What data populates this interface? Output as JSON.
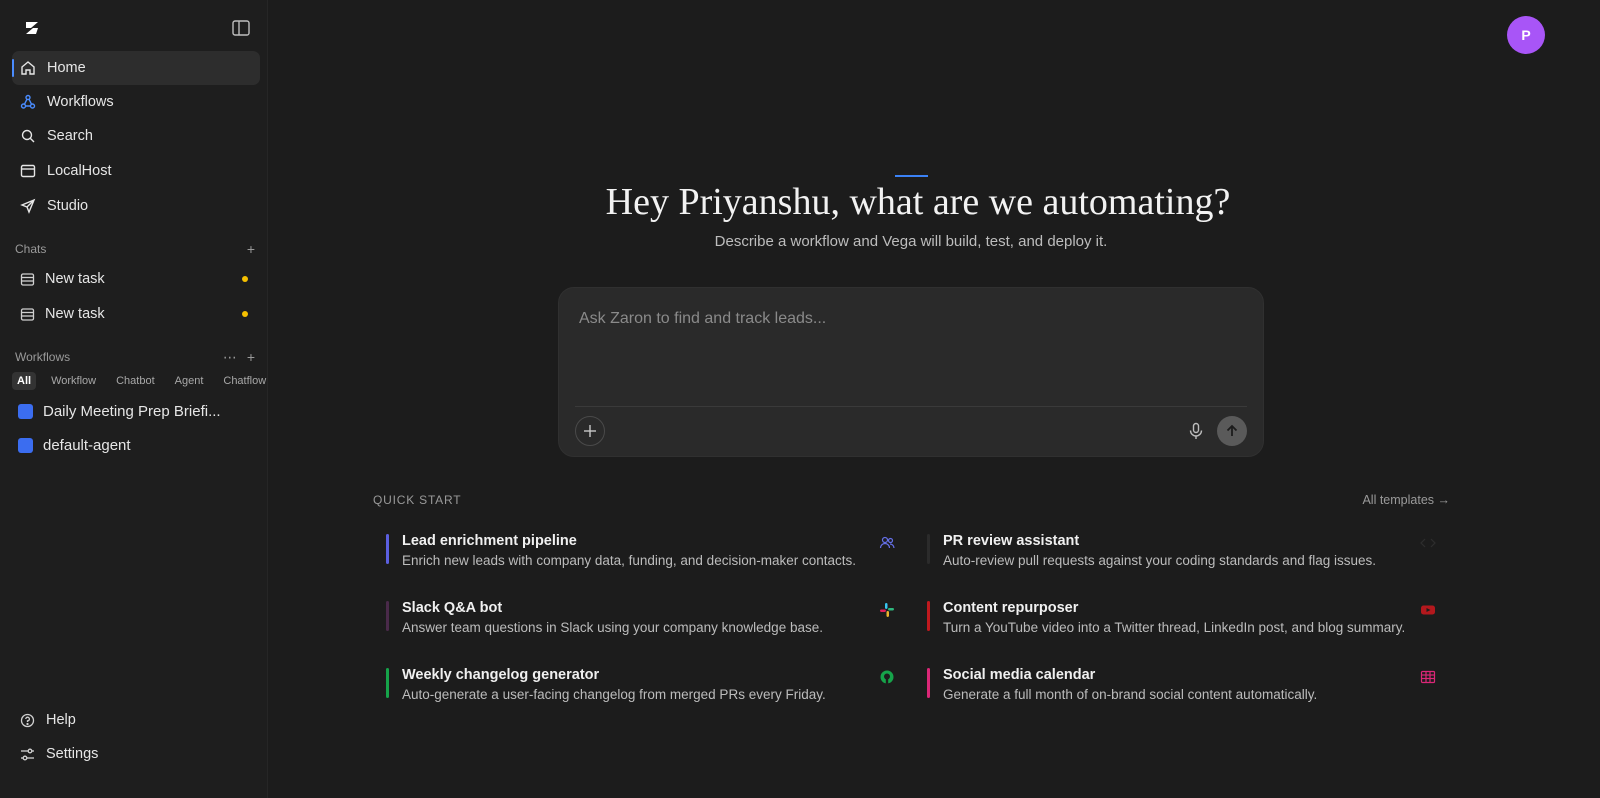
{
  "sidebar": {
    "logo_icon": "zaron-logo-icon",
    "nav": [
      {
        "label": "Home",
        "icon": "home-icon"
      },
      {
        "label": "Workflows",
        "icon": "workflow-icon"
      },
      {
        "label": "Search",
        "icon": "search-icon"
      },
      {
        "label": "LocalHost",
        "icon": "browser-window-icon"
      },
      {
        "label": "Studio",
        "icon": "send-icon"
      }
    ],
    "chats_heading": "Chats",
    "chats": [
      {
        "label": "New task",
        "status_color": "#f5c000"
      },
      {
        "label": "New task",
        "status_color": "#f5c000"
      }
    ],
    "workflows_heading": "Workflows",
    "filters": [
      "All",
      "Workflow",
      "Chatbot",
      "Agent",
      "Chatflow"
    ],
    "workflows": [
      {
        "label": "Daily Meeting Prep Briefi..."
      },
      {
        "label": "default-agent"
      }
    ],
    "help_label": "Help",
    "settings_label": "Settings"
  },
  "header": {
    "avatar_initial": "P",
    "avatar_color": "#a855f7"
  },
  "hero": {
    "title": "Hey Priyanshu, what are we automating?",
    "subtitle": "Describe a workflow and Vega will build, test, and deploy it."
  },
  "composer": {
    "placeholder": "Ask Zaron to find and track leads...",
    "value": ""
  },
  "quick_start": {
    "label": "QUICK START",
    "all_templates": "All templates →",
    "cards": [
      {
        "title": "Lead enrichment pipeline",
        "desc": "Enrich new leads with company data, funding, and decision-maker contacts.",
        "color": "#5b5fe0",
        "icon": "users-icon"
      },
      {
        "title": "PR review assistant",
        "desc": "Auto-review pull requests against your coding standards and flag issues.",
        "color": "#2b2b2b",
        "icon": "code-icon"
      },
      {
        "title": "Slack Q&A bot",
        "desc": "Answer team questions in Slack using your company knowledge base.",
        "color": "#4a2a4a",
        "icon": "slack-icon"
      },
      {
        "title": "Content repurposer",
        "desc": "Turn a YouTube video into a Twitter thread, LinkedIn post, and blog summary.",
        "color": "#c0191e",
        "icon": "youtube-icon"
      },
      {
        "title": "Weekly changelog generator",
        "desc": "Auto-generate a user-facing changelog from merged PRs every Friday.",
        "color": "#16a34a",
        "icon": "github-icon"
      },
      {
        "title": "Social media calendar",
        "desc": "Generate a full month of on-brand social content automatically.",
        "color": "#db2777",
        "icon": "calendar-grid-icon"
      }
    ]
  }
}
